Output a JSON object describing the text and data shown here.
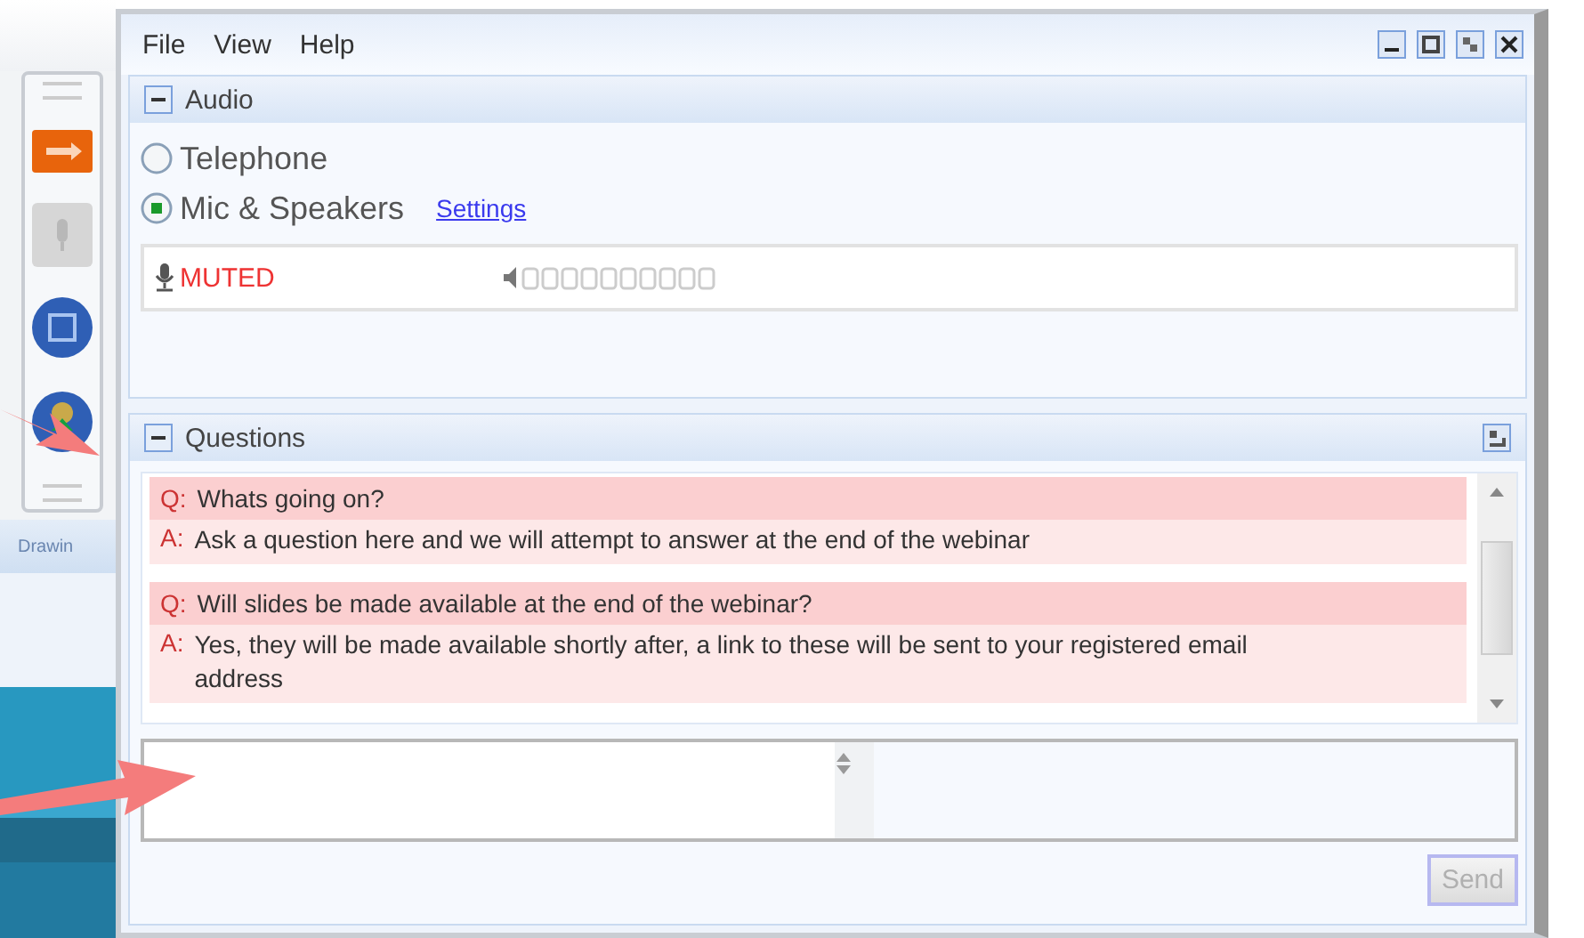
{
  "side_toolbar": {
    "caption": "Drawin"
  },
  "menu": [
    "File",
    "View",
    "Help"
  ],
  "window_controls": [
    {
      "kind": "minimize"
    },
    {
      "kind": "restore"
    },
    {
      "kind": "popout"
    },
    {
      "kind": "close"
    }
  ],
  "audio": {
    "title": "Audio",
    "expanded": true,
    "options": [
      {
        "label": "Telephone",
        "selected": false
      },
      {
        "label": "Mic & Speakers",
        "selected": true
      }
    ],
    "settings_link": "Settings",
    "mic_status": "MUTED"
  },
  "questions": {
    "title": "Questions",
    "expanded": true,
    "items": [
      {
        "q_prefix": "Q:",
        "question": "Whats going on?",
        "a_prefix": "A:",
        "answer": "Ask a question here and we will attempt to answer at the end of the webinar"
      },
      {
        "q_prefix": "Q:",
        "question": "Will slides be made available at the end of the webinar?",
        "a_prefix": "A:",
        "answer": "Yes, they will be made available shortly after, a link to these will be sent to your registered email address"
      }
    ],
    "send_button": {
      "label": "Send",
      "disabled": true
    }
  }
}
